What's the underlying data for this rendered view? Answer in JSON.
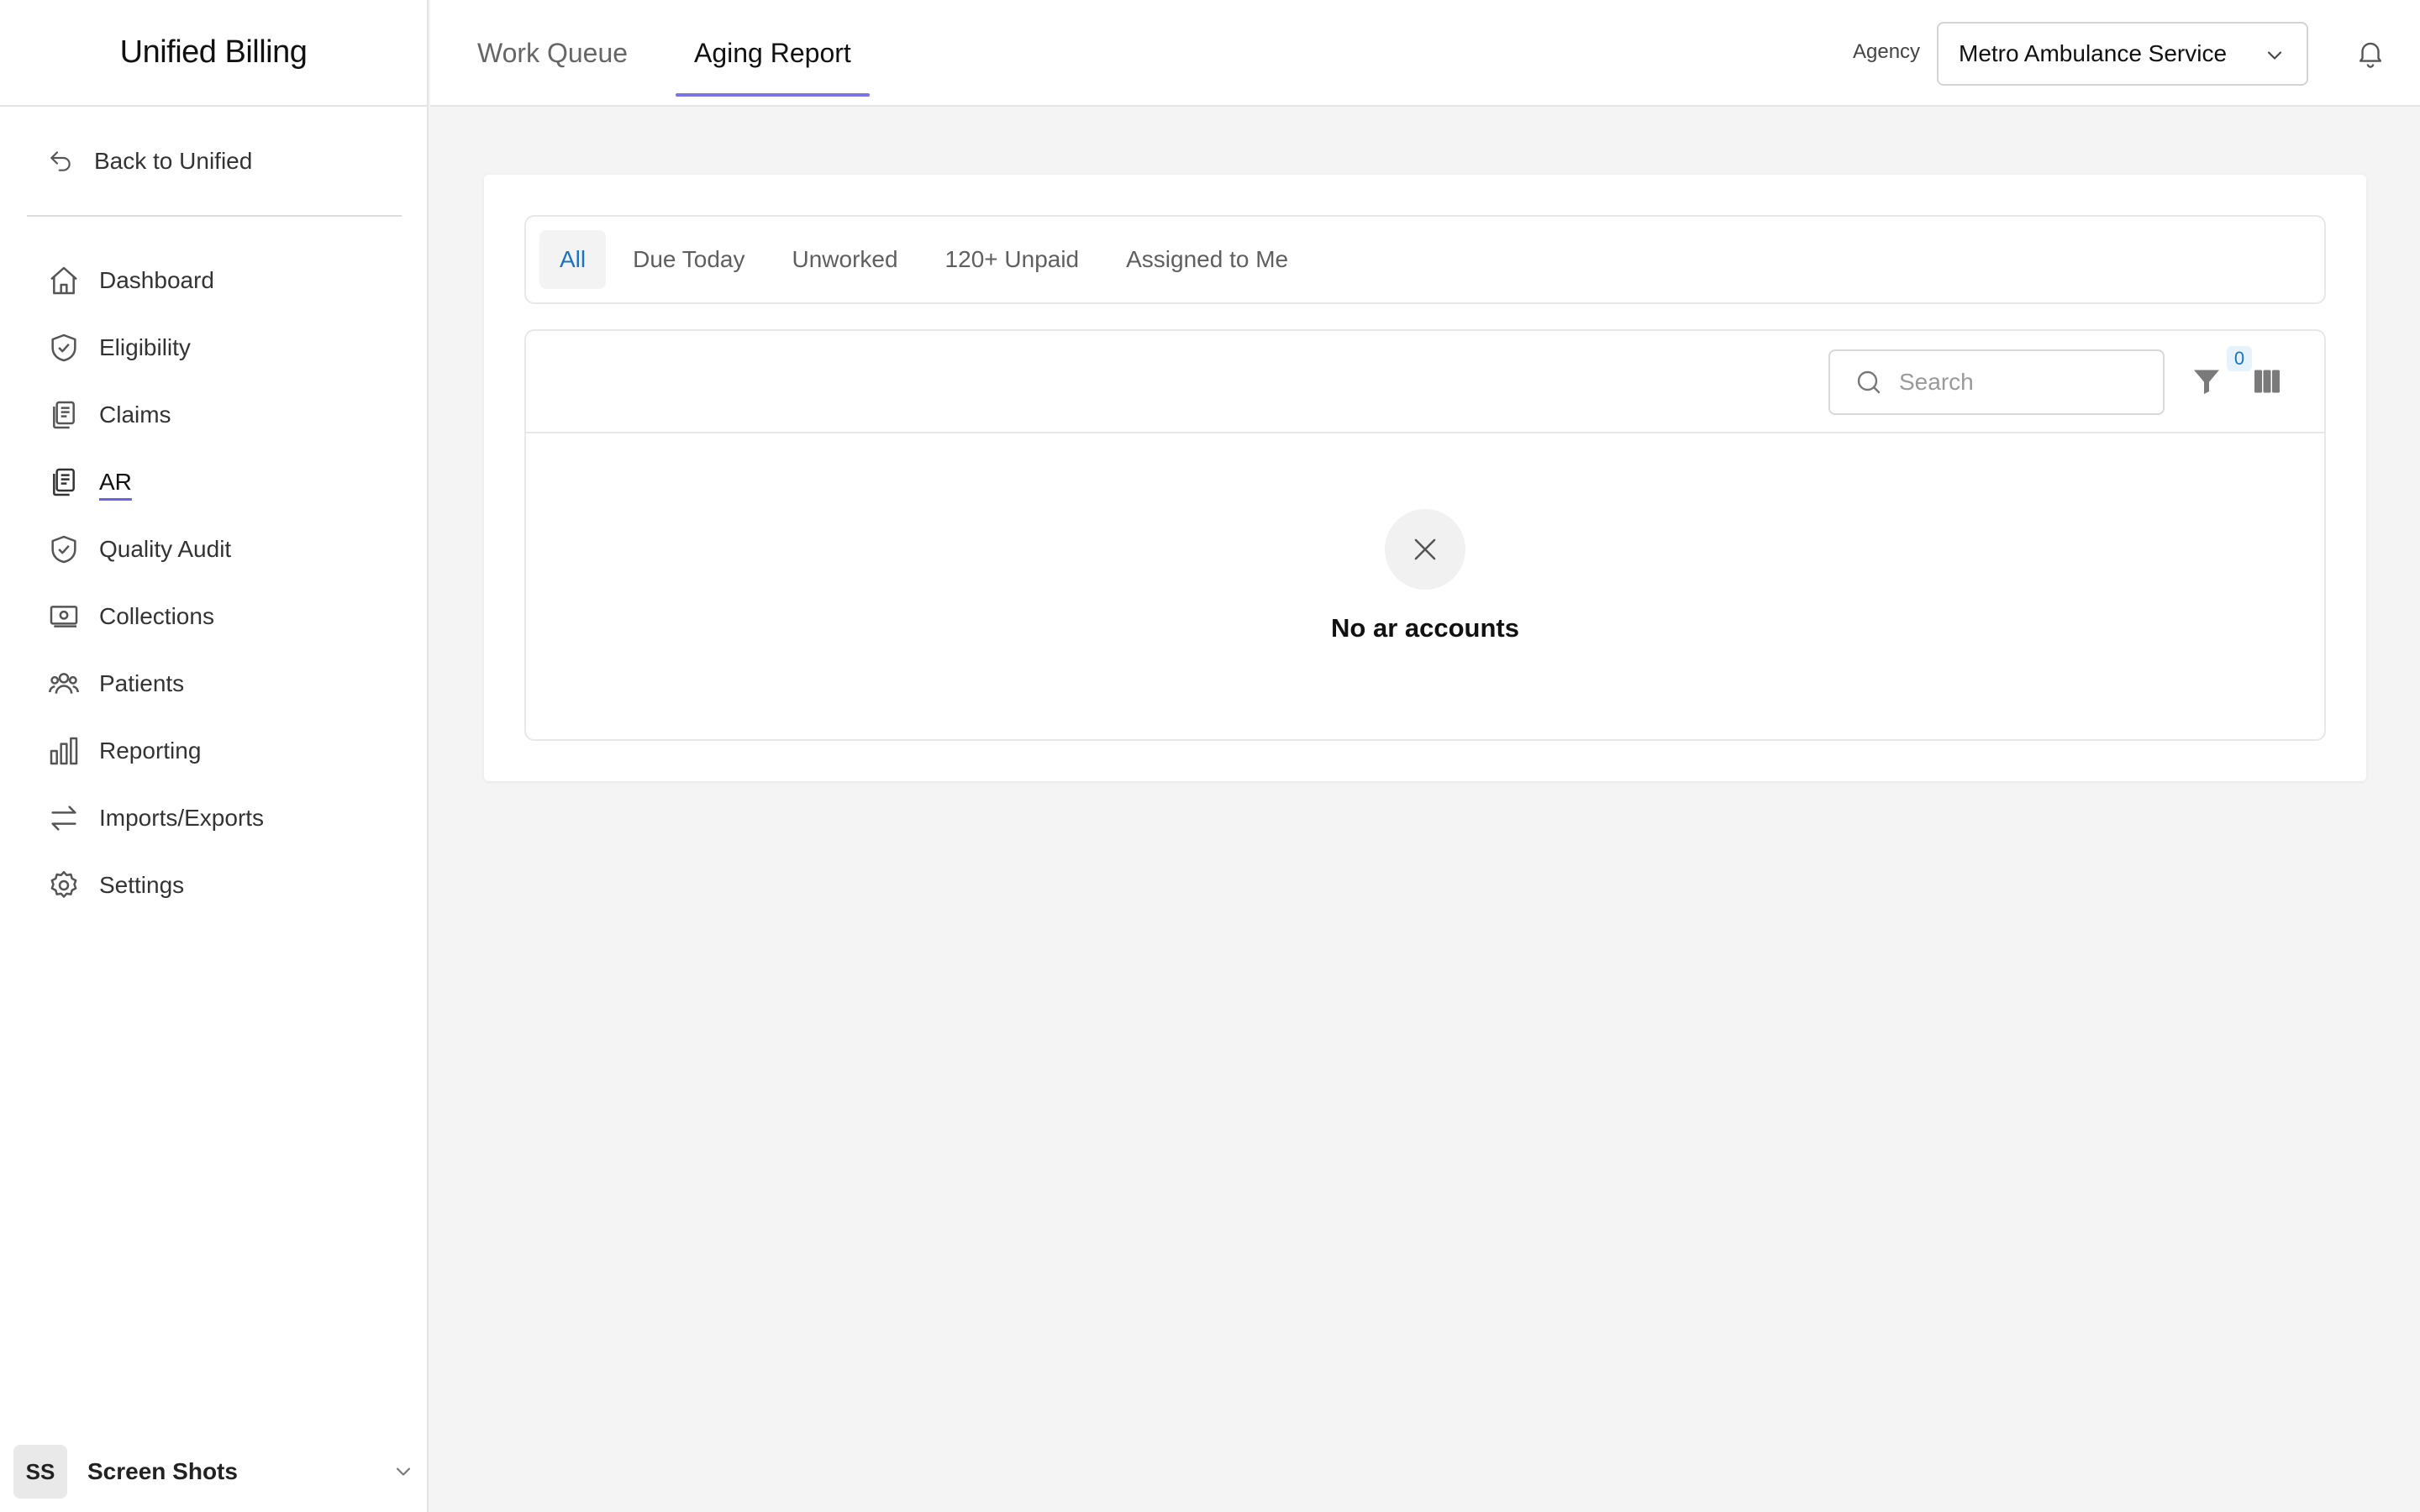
{
  "app": {
    "title": "Unified Billing"
  },
  "sidebar": {
    "back_label": "Back to Unified",
    "items": [
      {
        "label": "Dashboard",
        "icon": "home-icon"
      },
      {
        "label": "Eligibility",
        "icon": "shield-check-icon"
      },
      {
        "label": "Claims",
        "icon": "documents-icon"
      },
      {
        "label": "AR",
        "icon": "documents-icon",
        "active": true
      },
      {
        "label": "Quality Audit",
        "icon": "shield-check-icon"
      },
      {
        "label": "Collections",
        "icon": "cash-icon"
      },
      {
        "label": "Patients",
        "icon": "users-icon"
      },
      {
        "label": "Reporting",
        "icon": "bar-chart-icon"
      },
      {
        "label": "Imports/Exports",
        "icon": "arrows-left-right-icon"
      },
      {
        "label": "Settings",
        "icon": "gear-icon"
      }
    ],
    "user": {
      "initials": "SS",
      "name": "Screen Shots"
    }
  },
  "header": {
    "tabs": [
      {
        "label": "Work Queue",
        "active": false
      },
      {
        "label": "Aging Report",
        "active": true
      }
    ],
    "agency_label": "Agency",
    "agency_value": "Metro Ambulance Service"
  },
  "main": {
    "filter_tabs": [
      "All",
      "Due Today",
      "Unworked",
      "120+ Unpaid",
      "Assigned to Me"
    ],
    "active_filter": "All",
    "search": {
      "placeholder": "Search",
      "value": ""
    },
    "filter_count": "0",
    "empty_message": "No ar accounts"
  },
  "colors": {
    "accent": "#7b74e8",
    "link_blue": "#1a73c6",
    "background": "#f4f4f4"
  }
}
